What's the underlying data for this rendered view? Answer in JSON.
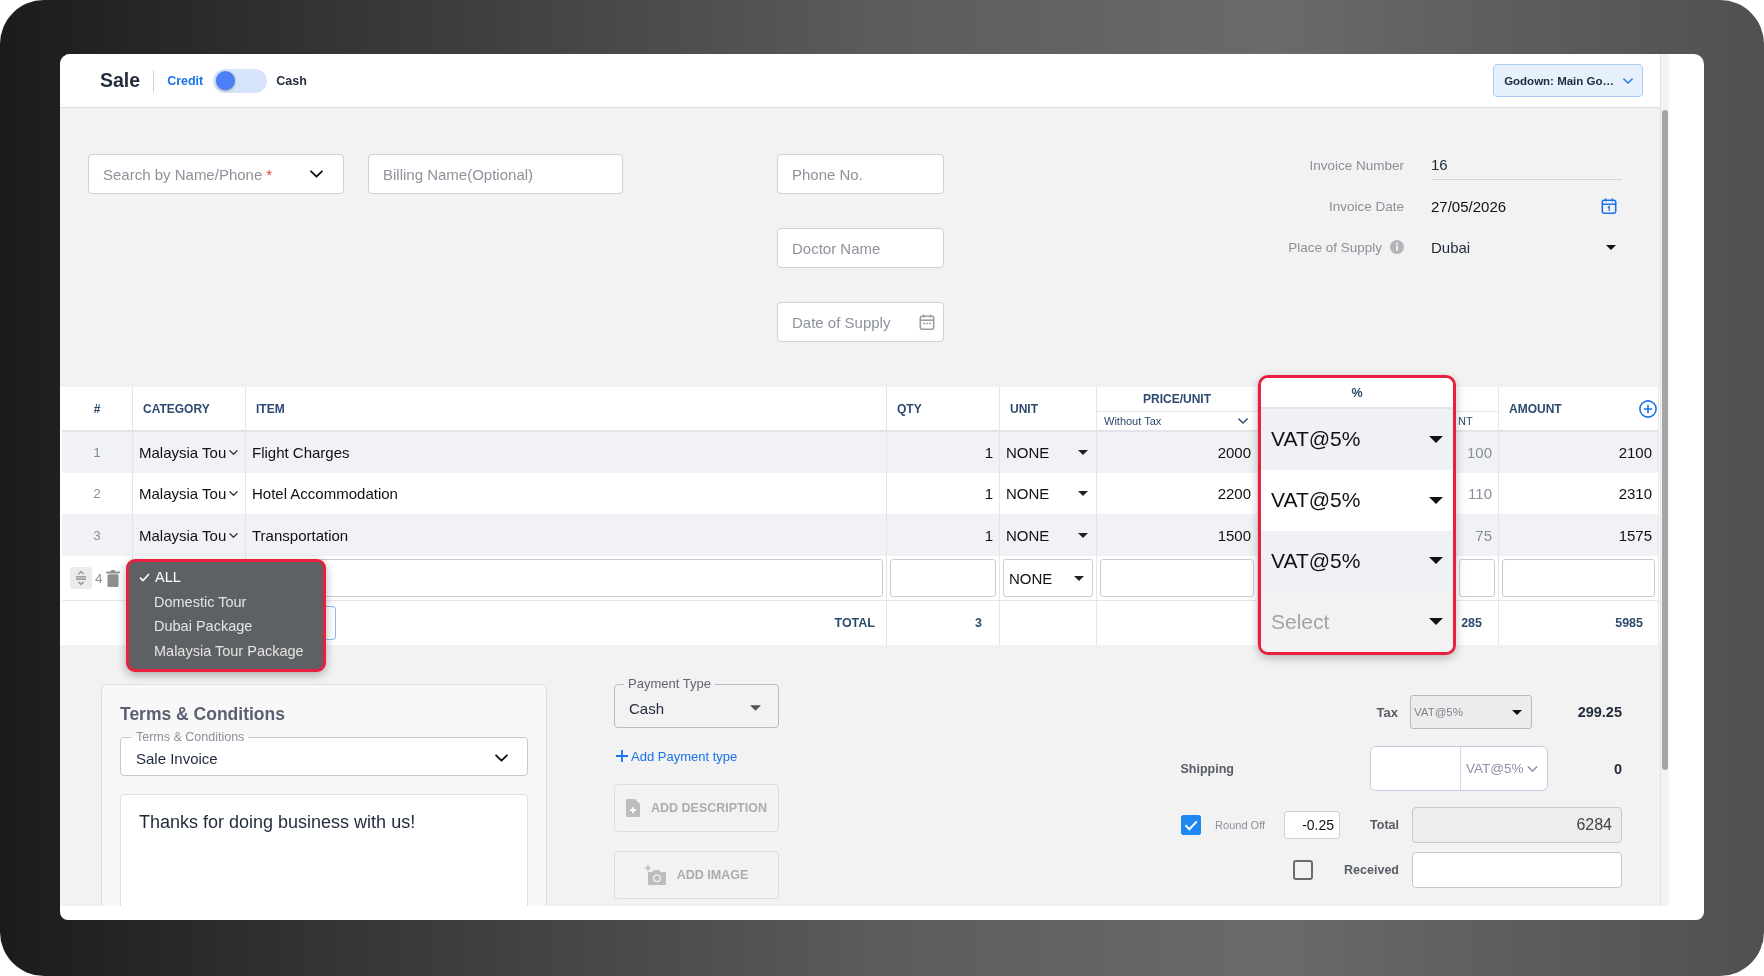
{
  "header": {
    "title": "Sale",
    "mode_options": [
      {
        "label": "Credit",
        "selected": true
      },
      {
        "label": "Cash",
        "selected": false
      }
    ],
    "toggle_on": false,
    "godown": "Godown: Main Go…"
  },
  "form": {
    "customer_search": {
      "placeholder": "Search by Name/Phone",
      "required_mark": "*"
    },
    "billing_name": {
      "placeholder": "Billing Name(Optional)"
    },
    "phone": {
      "placeholder": "Phone No."
    },
    "doctor_name": {
      "placeholder": "Doctor Name"
    },
    "date_of_supply": {
      "placeholder": "Date of Supply"
    }
  },
  "invoice": {
    "number": {
      "label": "Invoice Number",
      "value": "16"
    },
    "date": {
      "label": "Invoice Date",
      "value": "27/05/2026"
    },
    "place_of_supply": {
      "label": "Place of Supply",
      "value": "Dubai"
    }
  },
  "table": {
    "columns": [
      {
        "label": "#"
      },
      {
        "label": "CATEGORY"
      },
      {
        "label": "ITEM"
      },
      {
        "label": "QTY"
      },
      {
        "label": "UNIT"
      },
      {
        "label": "PRICE/UNIT",
        "sub_select": "Without Tax"
      },
      {
        "sub_label": "NT"
      },
      {
        "label": "AMOUNT"
      }
    ],
    "rows": [
      {
        "number": "1",
        "category": "Malaysia Tou",
        "item": "Flight Charges",
        "qty": "1",
        "unit": "NONE",
        "price": "2000",
        "tax_amount": "100",
        "amount": "2100"
      },
      {
        "number": "2",
        "category": "Malaysia Tou",
        "item": "Hotel Accommodation",
        "qty": "1",
        "unit": "NONE",
        "price": "2200",
        "tax_amount": "110",
        "amount": "2310"
      },
      {
        "number": "3",
        "category": "Malaysia Tou",
        "item": "Transportation",
        "qty": "1",
        "unit": "NONE",
        "price": "1500",
        "tax_amount": "75",
        "amount": "1575"
      }
    ],
    "new_row": {
      "number": "4",
      "unit": "NONE"
    },
    "totals": {
      "label": "TOTAL",
      "qty": "3",
      "tax_amount": "285",
      "amount": "5985"
    },
    "category_dropdown": {
      "options": [
        {
          "label": "ALL",
          "selected": true
        },
        {
          "label": "Domestic Tour",
          "selected": false
        },
        {
          "label": "Dubai Package",
          "selected": false
        },
        {
          "label": "Malaysia Tour Package",
          "selected": false
        }
      ]
    },
    "tax_callout": {
      "header": "%",
      "cells": [
        {
          "value": "VAT@5%"
        },
        {
          "value": "VAT@5%"
        },
        {
          "value": "VAT@5%"
        },
        {
          "placeholder": "Select"
        }
      ]
    }
  },
  "terms": {
    "title": "Terms & Conditions",
    "select_label": "Terms & Conditions",
    "select_value": "Sale Invoice",
    "text": "Thanks for doing business with us!"
  },
  "payment": {
    "type_label": "Payment Type",
    "type_value": "Cash",
    "add_link": "Add Payment type",
    "buttons": [
      {
        "kind": "description",
        "label": "ADD DESCRIPTION",
        "disabled": true
      },
      {
        "kind": "image",
        "label": "ADD IMAGE",
        "disabled": true
      }
    ]
  },
  "summary": {
    "tax": {
      "label": "Tax",
      "select": "VAT@5%",
      "value": "299.25"
    },
    "shipping": {
      "label": "Shipping",
      "tax_select": "VAT@5%",
      "value": "0"
    },
    "round_off": {
      "label": "Round Off",
      "checked": true,
      "value": "-0.25"
    },
    "total": {
      "label": "Total",
      "value": "6284"
    },
    "received": {
      "label": "Received",
      "checked": false
    }
  }
}
